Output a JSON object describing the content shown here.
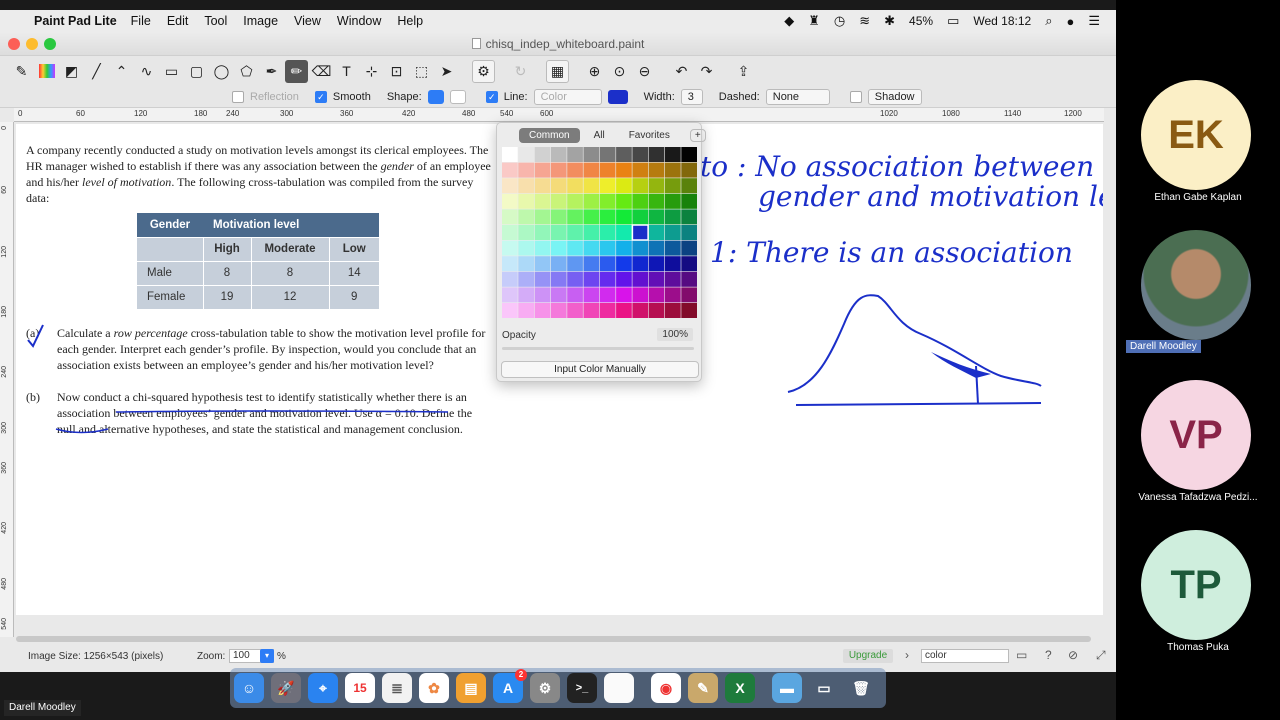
{
  "menubar": {
    "app": "Paint Pad Lite",
    "menus": [
      "File",
      "Edit",
      "Tool",
      "Image",
      "View",
      "Window",
      "Help"
    ],
    "battery": "45%",
    "clock": "Wed 18:12"
  },
  "window": {
    "title": "chisq_indep_whiteboard.paint"
  },
  "options": {
    "reflection": "Reflection",
    "smooth": "Smooth",
    "shape": "Shape:",
    "line": "Line:",
    "color": "Color",
    "width_label": "Width:",
    "width_value": "3",
    "dashed_label": "Dashed:",
    "dashed_value": "None",
    "shadow": "Shadow"
  },
  "ruler": {
    "ticks": [
      "0",
      "60",
      "120",
      "180",
      "240",
      "300",
      "360",
      "420",
      "480",
      "540",
      "600",
      "1020",
      "1080",
      "1140",
      "1200"
    ],
    "vticks": [
      "0",
      "60",
      "120",
      "180",
      "240",
      "300",
      "360",
      "420",
      "480",
      "540"
    ]
  },
  "problem": {
    "intro_1": "A company recently conducted a study on motivation levels amongst its clerical employees. The HR manager wished to establish if there was any association between the ",
    "intro_gender": "gender",
    "intro_2": " of an employee and his/her ",
    "intro_motivation": "level of motivation",
    "intro_3": ". The following cross-tabulation was compiled from the survey data:",
    "table": {
      "col_gender": "Gender",
      "col_group": "Motivation level",
      "subcols": [
        "High",
        "Moderate",
        "Low"
      ],
      "rows": [
        {
          "label": "Male",
          "values": [
            "8",
            "8",
            "14"
          ]
        },
        {
          "label": "Female",
          "values": [
            "19",
            "12",
            "9"
          ]
        }
      ]
    },
    "a_label": "(a)",
    "a_text_1": "Calculate a ",
    "a_text_italic": "row percentage",
    "a_text_2": " cross-tabulation table to show the motivation level profile for each gender. Interpret each gender’s profile. By inspection, would you conclude that an association exists between an employee’s gender and his/her motivation level?",
    "b_label": "(b)",
    "b_text": "Now conduct a chi-squared hypothesis test to identify statistically whether there is an association between employees’ gender and motivation level. Use α = 0.10. Define the null and alternative hypotheses, and state the statistical and management conclusion."
  },
  "handwriting": {
    "h0_line1": "to : No association between",
    "h0_line2": "gender and motivation level",
    "h1_line": "1: There is an association"
  },
  "picker": {
    "tabs": [
      "Common",
      "All",
      "Favorites"
    ],
    "add": "+",
    "opacity_label": "Opacity",
    "opacity_value": "100%",
    "manual": "Input Color Manually",
    "selected_color": "#1b2fc9"
  },
  "status": {
    "image_size": "Image Size: 1256×543 (pixels)",
    "zoom_label": "Zoom:",
    "zoom_value": "100",
    "zoom_unit": "%",
    "upgrade": "Upgrade",
    "search_value": "color"
  },
  "dock": {
    "calendar_day": "15",
    "appstore_badge": "2"
  },
  "presenter": "Darell Moodley",
  "participants": [
    {
      "initials": "EK",
      "name": "Ethan Gabe Kaplan",
      "bg": "#fbefc6",
      "fg": "#8a5a12"
    },
    {
      "initials": "",
      "name": "Darell Moodley",
      "bg": "#5a4a3a",
      "fg": "#fff"
    },
    {
      "initials": "VP",
      "name": "Vanessa Tafadzwa Pedzi...",
      "bg": "#f6d6e2",
      "fg": "#8a2448"
    },
    {
      "initials": "TP",
      "name": "Thomas Puka",
      "bg": "#cfeedd",
      "fg": "#1d5a3a"
    }
  ]
}
